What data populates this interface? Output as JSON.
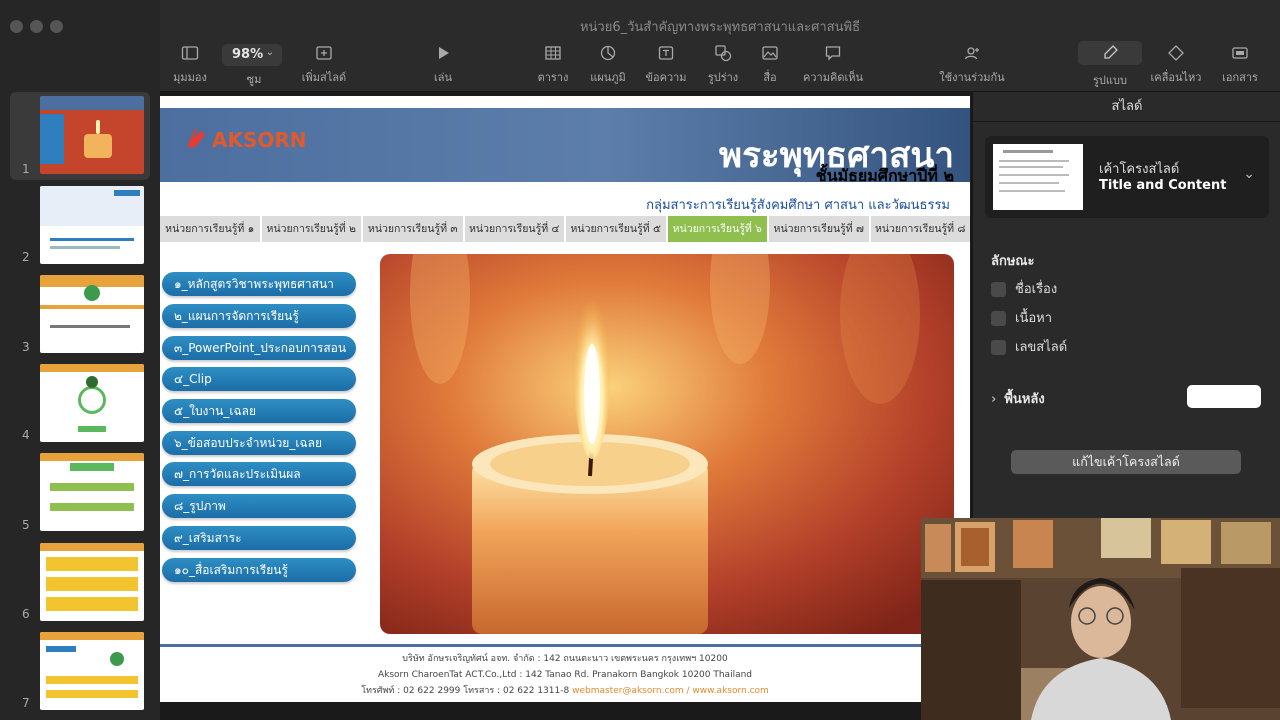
{
  "app": {
    "document_title": "หน่วย6_วันสำคัญทางพระพุทธศาสนาและศาสนพิธี",
    "zoom": "98%"
  },
  "toolbar": {
    "items": [
      {
        "label": "มุมมอง",
        "icon": "sidebar-icon"
      },
      {
        "label": "ซูม",
        "icon": "zoom-dropdown"
      },
      {
        "label": "เพิ่มสไลด์",
        "icon": "add-slide-icon"
      },
      {
        "label": "เล่น",
        "icon": "play-icon"
      },
      {
        "label": "ตาราง",
        "icon": "table-icon"
      },
      {
        "label": "แผนภูมิ",
        "icon": "chart-icon"
      },
      {
        "label": "ข้อความ",
        "icon": "text-icon"
      },
      {
        "label": "รูปร่าง",
        "icon": "shape-icon"
      },
      {
        "label": "สื่อ",
        "icon": "media-icon"
      },
      {
        "label": "ความคิดเห็น",
        "icon": "comment-icon"
      },
      {
        "label": "ใช้งานร่วมกัน",
        "icon": "collaborate-icon"
      },
      {
        "label": "รูปแบบ",
        "icon": "format-brush-icon"
      },
      {
        "label": "เคลื่อนไหว",
        "icon": "animate-icon"
      },
      {
        "label": "เอกสาร",
        "icon": "document-icon"
      }
    ]
  },
  "navigator": {
    "selected": 1,
    "thumbnails": [
      "1",
      "2",
      "3",
      "4",
      "5",
      "6",
      "7"
    ]
  },
  "slide": {
    "logo": "AKSORN",
    "title": "พระพุทธศาสนา",
    "subtitle": "ชั้นมัธยมศึกษาปีที่ ๒",
    "group": "กลุ่มสาระการเรียนรู้สังคมศึกษา ศาสนา และวัฒนธรรม",
    "unit_tabs": [
      "หน่วยการเรียนรู้ที่ ๑",
      "หน่วยการเรียนรู้ที่ ๒",
      "หน่วยการเรียนรู้ที่ ๓",
      "หน่วยการเรียนรู้ที่ ๔",
      "หน่วยการเรียนรู้ที่ ๕",
      "หน่วยการเรียนรู้ที่ ๖",
      "หน่วยการเรียนรู้ที่ ๗",
      "หน่วยการเรียนรู้ที่ ๘"
    ],
    "active_tab_index": 5,
    "menu": [
      "๑_หลักสูตรวิชาพระพุทธศาสนา",
      "๒_แผนการจัดการเรียนรู้",
      "๓_PowerPoint_ประกอบการสอน",
      "๔_Clip",
      "๕_ใบงาน_เฉลย",
      "๖_ข้อสอบประจำหน่วย_เฉลย",
      "๗_การวัดและประเมินผล",
      "๘_รูปภาพ",
      "๙_เสริมสาระ",
      "๑๐_สื่อเสริมการเรียนรู้"
    ],
    "footer": {
      "line1": "บริษัท อักษรเจริญทัศน์ อจท. จำกัด : 142 ถนนตะนาว เขตพระนคร กรุงเทพฯ 10200",
      "line2": "Aksorn CharoenTat ACT.Co.,Ltd : 142 Tanao Rd. Pranakorn Bangkok 10200 Thailand",
      "line3_prefix": "โทรศัพท์ : 02 622 2999  โทรสาร : 02 622 1311-8",
      "line3_links": "webmaster@aksorn.com / www.aksorn.com"
    }
  },
  "inspector": {
    "header": "สไลด์",
    "layout_name_th": "เค้าโครงสไลด์",
    "layout_name_en": "Title and Content",
    "appearance_label": "ลักษณะ",
    "checkboxes": [
      "ชื่อเรื่อง",
      "เนื้อหา",
      "เลขสไลด์"
    ],
    "background_label": "พื้นหลัง",
    "edit_layout_button": "แก้ไขเค้าโครงสไลด์"
  },
  "colors": {
    "header_blue": "#4c6fa0",
    "menu_blue": "#1c6da8",
    "active_tab_green": "#8fbf4f",
    "link_orange": "#e68a2e"
  }
}
